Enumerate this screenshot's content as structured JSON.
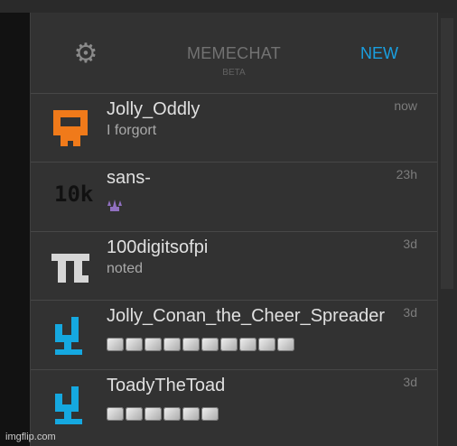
{
  "app": {
    "title": "MEMECHAT",
    "subtitle": "BETA",
    "new_label": "NEW"
  },
  "colors": {
    "accent": "#1a9fe0",
    "orange_icon": "#f07a1a",
    "cyan_icon": "#15a8e0",
    "purple_icon": "#9070c0"
  },
  "conversations": [
    {
      "name": "Jolly_Oddly",
      "preview": "I forgort",
      "time": "now",
      "icon": "orange-pixel-face-icon"
    },
    {
      "name": "sans-",
      "icon_text": "10k",
      "preview_icon": "purple-sparkle-icon",
      "time": "23h"
    },
    {
      "name": "100digitsofpi",
      "preview": "noted",
      "time": "3d",
      "icon": "pi-symbol-icon"
    },
    {
      "name": "Jolly_Conan_the_Cheer_Spreader",
      "preview_emoji_count": 10,
      "time": "3d",
      "icon": "blue-pixel-stool-icon"
    },
    {
      "name": "ToadyTheToad",
      "preview_emoji_count": 6,
      "time": "3d",
      "icon": "blue-pixel-stool-icon"
    }
  ],
  "watermark": "imgflip.com"
}
